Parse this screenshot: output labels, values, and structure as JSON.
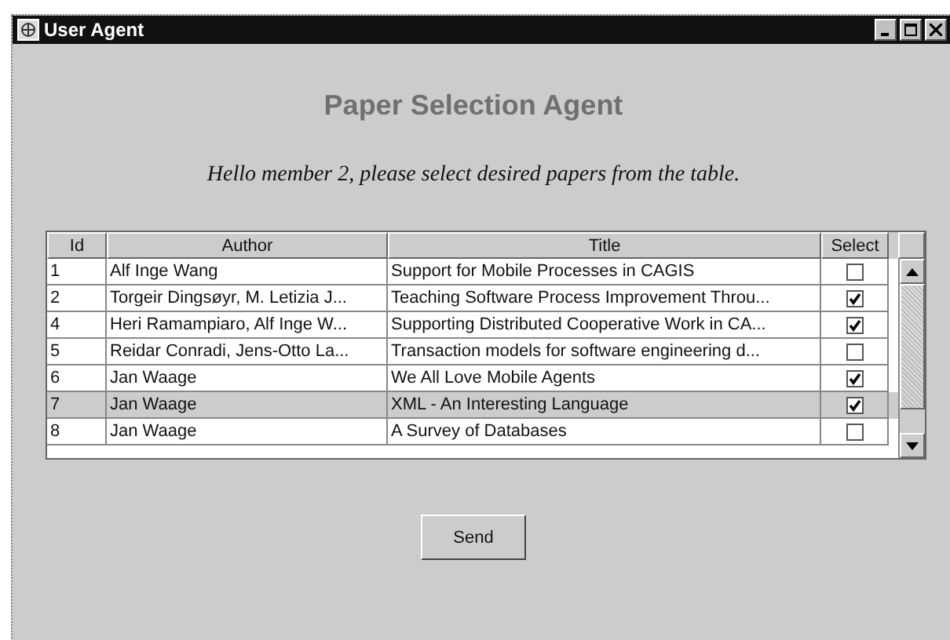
{
  "window": {
    "title": "User Agent"
  },
  "heading": "Paper Selection Agent",
  "greeting": "Hello member 2, please select desired papers from the table.",
  "table": {
    "columns": [
      "Id",
      "Author",
      "Title",
      "Select"
    ],
    "rows": [
      {
        "id": "1",
        "author": "Alf Inge Wang",
        "title": "Support for Mobile Processes in CAGIS",
        "checked": false,
        "selected": false
      },
      {
        "id": "2",
        "author": "Torgeir Dingsøyr, M. Letizia J...",
        "title": "Teaching Software Process Improvement Throu...",
        "checked": true,
        "selected": false
      },
      {
        "id": "4",
        "author": "Heri Ramampiaro, Alf Inge W...",
        "title": "Supporting Distributed Cooperative Work in CA...",
        "checked": true,
        "selected": false
      },
      {
        "id": "5",
        "author": "Reidar Conradi, Jens-Otto La...",
        "title": "Transaction models for software engineering d...",
        "checked": false,
        "selected": false
      },
      {
        "id": "6",
        "author": "Jan Waage",
        "title": "We All Love Mobile Agents",
        "checked": true,
        "selected": false
      },
      {
        "id": "7",
        "author": "Jan Waage",
        "title": "XML - An Interesting Language",
        "checked": true,
        "selected": true
      },
      {
        "id": "8",
        "author": "Jan Waage",
        "title": "A Survey of Databases",
        "checked": false,
        "selected": false
      }
    ]
  },
  "send_button": "Send"
}
